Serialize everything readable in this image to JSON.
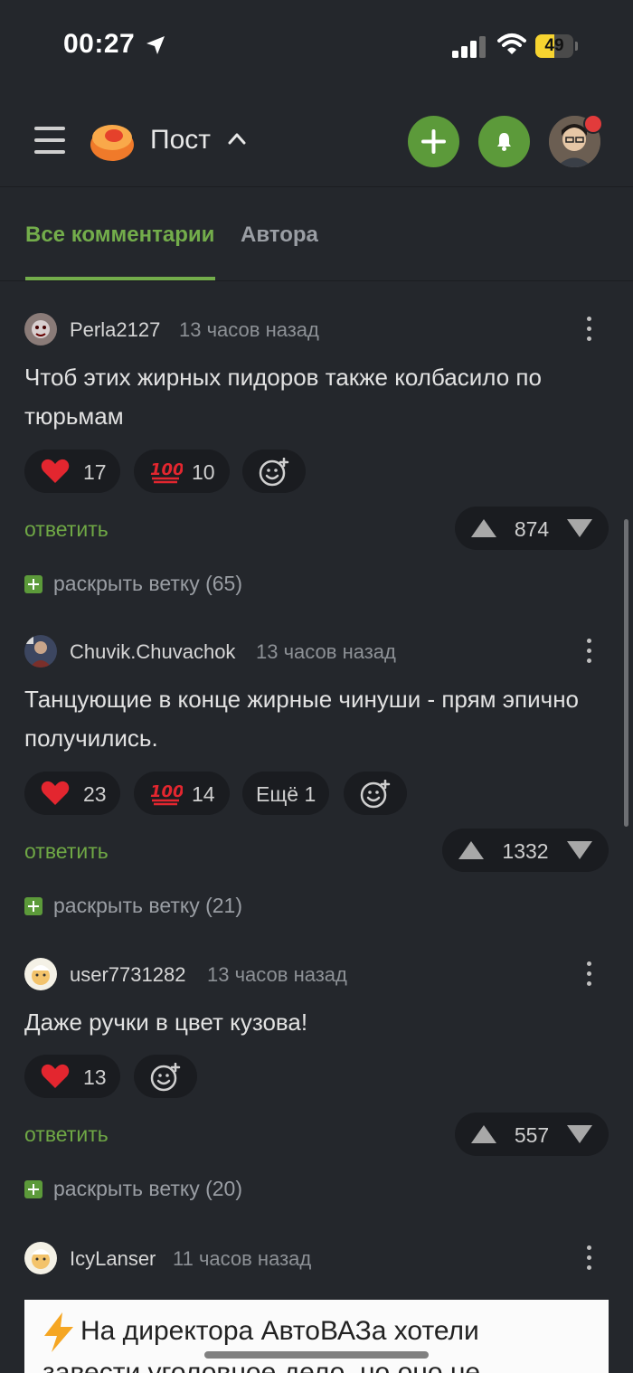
{
  "status_bar": {
    "time": "00:27",
    "battery": "49",
    "battery_level": 0.49
  },
  "header": {
    "title": "Пост"
  },
  "tabs": [
    {
      "label": "Все комментарии",
      "active": true
    },
    {
      "label": "Автора",
      "active": false
    }
  ],
  "comments": [
    {
      "author": "Perla2127",
      "time": "13 часов назад",
      "text": "Чтоб этих жирных пидоров также колбасило по тюрьмам",
      "reactions": {
        "heart": "17",
        "hundred": "10"
      },
      "reply": "ответить",
      "rating": "874",
      "expand": "раскрыть ветку (65)"
    },
    {
      "author": "Chuvik.Chuvachok",
      "time": "13 часов назад",
      "text": "Танцующие в конце жирные чинуши - прям эпично получились.",
      "reactions": {
        "heart": "23",
        "hundred": "14",
        "more": "Ещё 1"
      },
      "reply": "ответить",
      "rating": "1332",
      "expand": "раскрыть ветку (21)"
    },
    {
      "author": "user7731282",
      "time": "13 часов назад",
      "text": "Даже ручки в цвет кузова!",
      "reactions": {
        "heart": "13"
      },
      "reply": "ответить",
      "rating": "557",
      "expand": "раскрыть ветку (20)"
    },
    {
      "author": "IcyLanser",
      "time": "11 часов назад",
      "image_text_line1": "На директора АвтоВАЗа хотели",
      "image_text_line2": "завести уголовное дело, но оно не"
    }
  ],
  "colors": {
    "accent": "#73ad4b",
    "button_green": "#5c9a3a",
    "background": "#24272c",
    "heart": "#e3262f"
  }
}
